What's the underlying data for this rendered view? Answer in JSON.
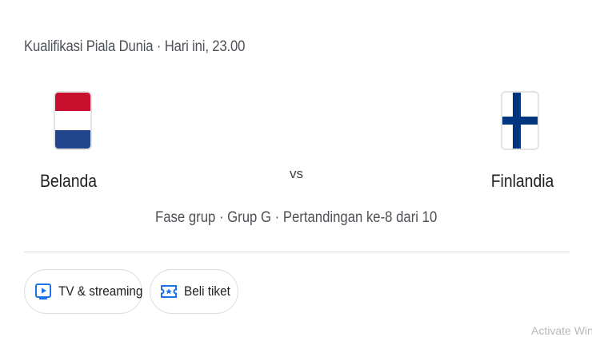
{
  "match": {
    "header": "Kualifikasi Piala Dunia · Hari ini, 23.00",
    "home_team": "Belanda",
    "away_team": "Finlandia",
    "vs": "vs",
    "stage": "Fase grup · Grup G · Pertandingan ke-8 dari 10"
  },
  "flags": {
    "home": {
      "icon": "netherlands-flag-icon",
      "colors": [
        "#c8102e",
        "#ffffff",
        "#21468b"
      ]
    },
    "away": {
      "icon": "finland-flag-icon",
      "colors": [
        "#ffffff",
        "#003580"
      ]
    }
  },
  "actions": {
    "tv_label": "TV & streaming",
    "tv_icon": "tv-play-icon",
    "tickets_label": "Beli tiket",
    "tickets_icon": "ticket-icon",
    "accent": "#1a73e8"
  },
  "watermark": "Activate Wind"
}
